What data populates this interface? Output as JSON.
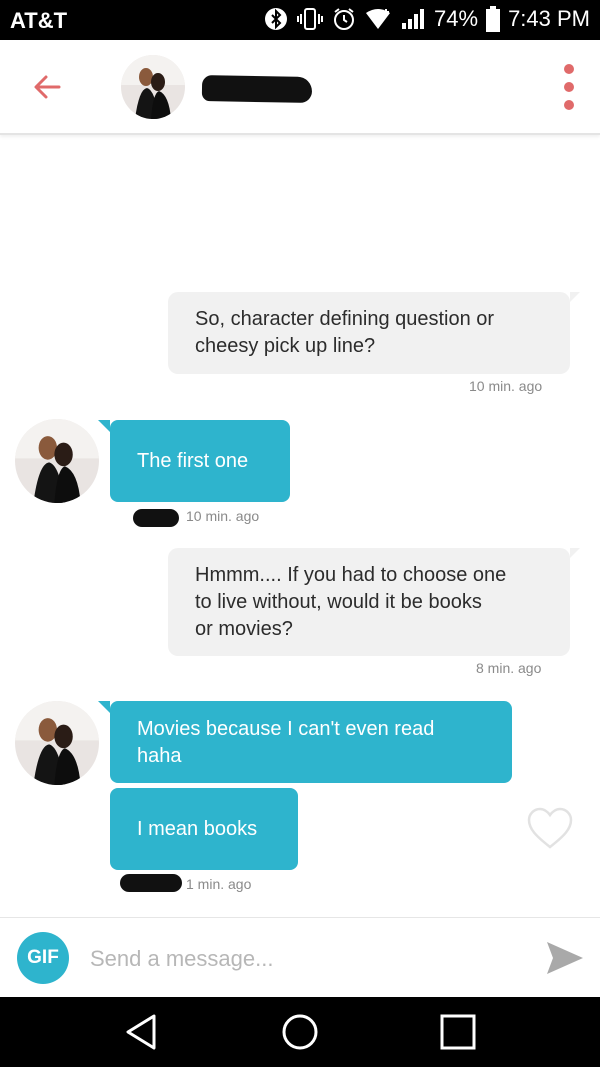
{
  "status_bar": {
    "carrier": "AT&T",
    "battery": "74%",
    "time": "7:43 PM",
    "icons": [
      "bluetooth-icon",
      "vibrate-icon",
      "alarm-icon",
      "wifi-icon",
      "signal-icon",
      "battery-icon"
    ]
  },
  "header": {
    "back_icon": "arrow-left-icon",
    "menu_icon": "more-vertical-icon",
    "accent_color": "#e06a6a"
  },
  "messages": [
    {
      "side": "outgoing",
      "lines": [
        "So, character defining question or",
        "cheesy pick up line?"
      ],
      "time": "10 min. ago"
    },
    {
      "side": "incoming",
      "lines": [
        "The first one"
      ],
      "time": "10 min. ago"
    },
    {
      "side": "outgoing",
      "lines": [
        "Hmmm.... If you had to choose one",
        "to live without, would it be books",
        "or movies?"
      ],
      "time": "8 min. ago"
    },
    {
      "side": "incoming",
      "lines": [
        "Movies because I can't even read",
        "haha"
      ]
    },
    {
      "side": "incoming",
      "lines": [
        "I mean books"
      ],
      "time": "1 min. ago"
    }
  ],
  "composer": {
    "gif_label": "GIF",
    "placeholder": "Send a message...",
    "send_icon": "send-icon"
  },
  "colors": {
    "incoming_bubble": "#2eb4cd",
    "outgoing_bubble": "#f1f1f1"
  }
}
